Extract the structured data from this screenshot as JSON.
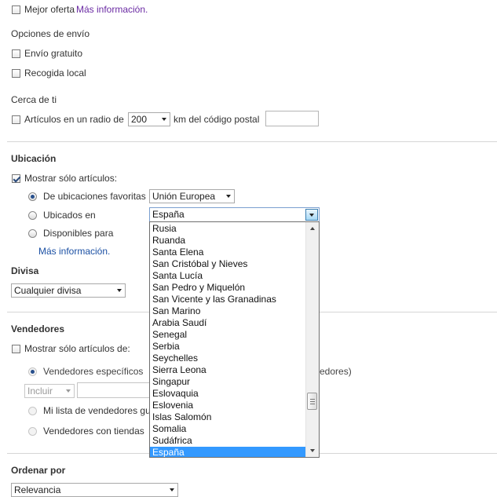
{
  "top": {
    "best_offer_label": "Mejor oferta",
    "best_offer_link": "Más información."
  },
  "shipping": {
    "title": "Opciones de envío",
    "free_shipping": "Envío gratuito",
    "local_pickup": "Recogida local"
  },
  "nearby": {
    "title": "Cerca de ti",
    "radius_label": "Artículos en un radio de",
    "radius_value": "200",
    "postal_label": "km del código postal",
    "postal_value": ""
  },
  "location": {
    "title": "Ubicación",
    "show_only_label": "Mostrar sólo artículos:",
    "favorites_label": "De ubicaciones favoritas",
    "favorites_value": "Unión Europea",
    "located_in_label": "Ubicados en",
    "located_in_value": "España",
    "available_for_label": "Disponibles para",
    "more_info_link": "Más información.",
    "dropdown_options": [
      "Rusia",
      "Ruanda",
      "Santa Elena",
      "San Cristóbal y Nieves",
      "Santa Lucía",
      "San Pedro y Miquelón",
      "San Vicente y las Granadinas",
      "San Marino",
      "Arabia Saudí",
      "Senegal",
      "Serbia",
      "Seychelles",
      "Sierra Leona",
      "Singapur",
      "Eslovaquia",
      "Eslovenia",
      "Islas Salomón",
      "Somalia",
      "Sudáfrica",
      "España"
    ],
    "dropdown_selected": "España"
  },
  "currency": {
    "title": "Divisa",
    "value": "Cualquier divisa"
  },
  "sellers": {
    "title": "Vendedores",
    "show_only_label": "Mostrar sólo artículos de:",
    "specific_label": "Vendedores específicos",
    "specific_suffix": "edores)",
    "include_value": "Incluir",
    "my_list_label": "Mi lista de vendedores gu",
    "stores_label": "Vendedores con tiendas"
  },
  "sort": {
    "title": "Ordenar por",
    "value": "Relevancia"
  }
}
